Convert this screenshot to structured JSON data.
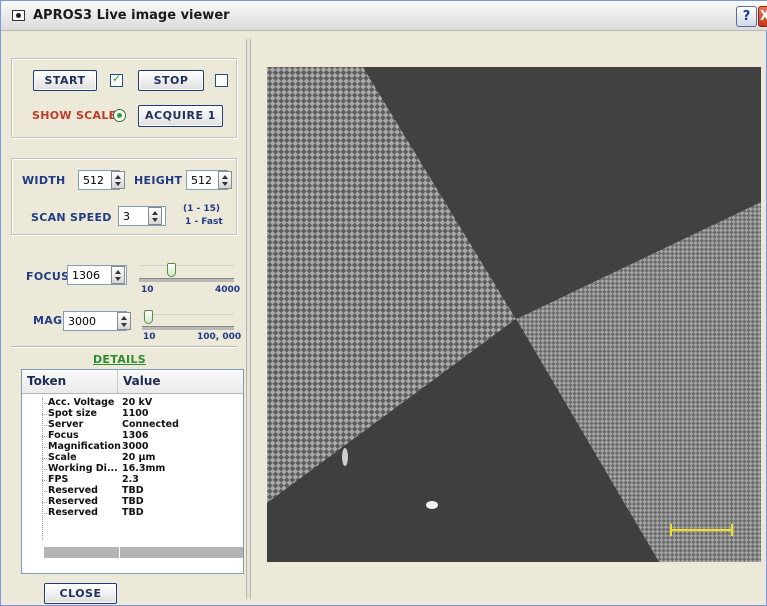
{
  "window": {
    "title": "APROS3 Live image viewer",
    "help_label": "?",
    "close_label": "X"
  },
  "controls": {
    "start_label": "START",
    "start_checked": true,
    "stop_label": "STOP",
    "stop_checked": false,
    "show_scale_label": "SHOW SCALE",
    "show_scale_selected": true,
    "acquire_label": "ACQUIRE 1"
  },
  "scan": {
    "width_label": "WIDTH",
    "width_value": "512",
    "height_label": "HEIGHT",
    "height_value": "512",
    "speed_label": "SCAN SPEED",
    "speed_value": "3",
    "speed_hint_line1": "(1 - 15)",
    "speed_hint_line2": "1 - Fast"
  },
  "focus": {
    "label": "FOCUS",
    "value": "1306",
    "min_label": "10",
    "max_label": "4000",
    "min": 10,
    "max": 4000,
    "current": 1306
  },
  "mag": {
    "label": "MAG",
    "value": "3000",
    "min_label": "10",
    "max_label": "100, 000",
    "min": 10,
    "max": 100000,
    "current": 3000
  },
  "details": {
    "link_label": "DETAILS",
    "header_token": "Token",
    "header_value": "Value",
    "rows": [
      {
        "token": "Acc. Voltage",
        "value": "20 kV"
      },
      {
        "token": "Spot size",
        "value": "1100"
      },
      {
        "token": "Server",
        "value": "Connected"
      },
      {
        "token": "Focus",
        "value": "1306"
      },
      {
        "token": "Magnification",
        "value": "3000"
      },
      {
        "token": "Scale",
        "value": "20 µm"
      },
      {
        "token": "Working Di...",
        "value": "16.3mm"
      },
      {
        "token": "FPS",
        "value": "2.3"
      },
      {
        "token": "Reserved",
        "value": "TBD"
      },
      {
        "token": "Reserved",
        "value": "TBD"
      },
      {
        "token": "Reserved",
        "value": "TBD"
      }
    ]
  },
  "footer": {
    "close_label": "CLOSE"
  },
  "colors": {
    "accent_blue": "#213a84",
    "show_scale_red": "#c0392b",
    "details_green": "#2e8b2e",
    "scale_bar_yellow": "#f0e020"
  }
}
